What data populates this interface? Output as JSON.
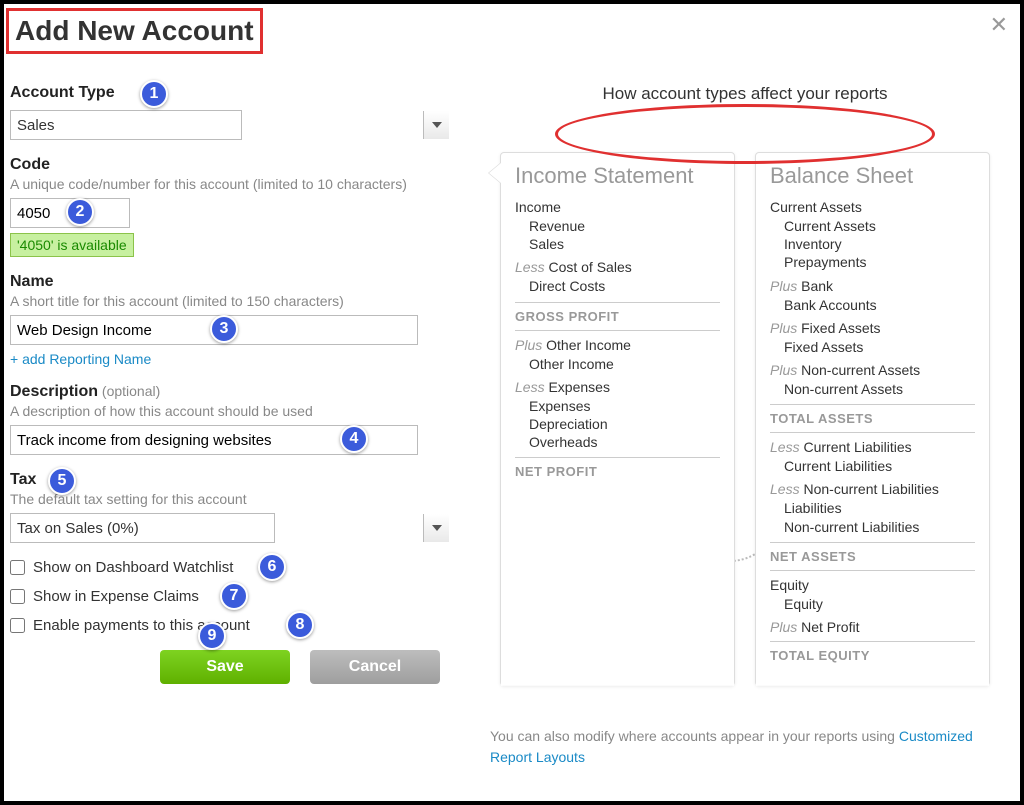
{
  "dialog": {
    "title": "Add New Account",
    "close": "✕"
  },
  "form": {
    "account_type": {
      "label": "Account Type",
      "value": "Sales"
    },
    "code": {
      "label": "Code",
      "help": "A unique code/number for this account (limited to 10 characters)",
      "value": "4050",
      "available": "'4050' is available"
    },
    "name": {
      "label": "Name",
      "help": "A short title for this account (limited to 150 characters)",
      "value": "Web Design Income",
      "add_reporting_link": "+ add Reporting Name"
    },
    "description": {
      "label": "Description",
      "optional": "(optional)",
      "help": "A description of how this account should be used",
      "value": "Track income from designing websites"
    },
    "tax": {
      "label": "Tax",
      "help": "The default tax setting for this account",
      "value": "Tax on Sales (0%)"
    },
    "checkboxes": {
      "dashboard": "Show on Dashboard Watchlist",
      "expense": "Show in Expense Claims",
      "payments": "Enable payments to this account"
    },
    "buttons": {
      "save": "Save",
      "cancel": "Cancel"
    }
  },
  "badges": {
    "b1": "1",
    "b2": "2",
    "b3": "3",
    "b4": "4",
    "b5": "5",
    "b6": "6",
    "b7": "7",
    "b8": "8",
    "b9": "9"
  },
  "info": {
    "header": "How account types affect your reports",
    "income_statement": {
      "title": "Income Statement",
      "sec1_label": "Income",
      "sec1_items": {
        "a": "Revenue",
        "b": "Sales"
      },
      "sec2_prefix": "Less",
      "sec2_label": "Cost of Sales",
      "sec2_items": {
        "a": "Direct Costs"
      },
      "gross": "GROSS PROFIT",
      "sec3_prefix": "Plus",
      "sec3_label": "Other Income",
      "sec3_items": {
        "a": "Other Income"
      },
      "sec4_prefix": "Less",
      "sec4_label": "Expenses",
      "sec4_items": {
        "a": "Expenses",
        "b": "Depreciation",
        "c": "Overheads"
      },
      "net": "NET PROFIT"
    },
    "balance_sheet": {
      "title": "Balance Sheet",
      "sec1_label": "Current Assets",
      "sec1_items": {
        "a": "Current Assets",
        "b": "Inventory",
        "c": "Prepayments"
      },
      "sec2_prefix": "Plus",
      "sec2_label": "Bank",
      "sec2_items": {
        "a": "Bank Accounts"
      },
      "sec3_prefix": "Plus",
      "sec3_label": "Fixed Assets",
      "sec3_items": {
        "a": "Fixed Assets"
      },
      "sec4_prefix": "Plus",
      "sec4_label": "Non-current Assets",
      "sec4_items": {
        "a": "Non-current Assets"
      },
      "total_assets": "TOTAL ASSETS",
      "sec5_prefix": "Less",
      "sec5_label": "Current Liabilities",
      "sec5_items": {
        "a": "Current Liabilities"
      },
      "sec6_prefix": "Less",
      "sec6_label": "Non-current Liabilities",
      "sec6_items": {
        "a": "Liabilities",
        "b": "Non-current Liabilities"
      },
      "net_assets": "NET ASSETS",
      "sec7_label": "Equity",
      "sec7_items": {
        "a": "Equity"
      },
      "sec8_prefix": "Plus",
      "sec8_label": "Net Profit",
      "total_equity": "TOTAL EQUITY"
    },
    "footer": {
      "text": "You can also modify where accounts appear in your reports using ",
      "link": "Customized Report Layouts"
    }
  }
}
